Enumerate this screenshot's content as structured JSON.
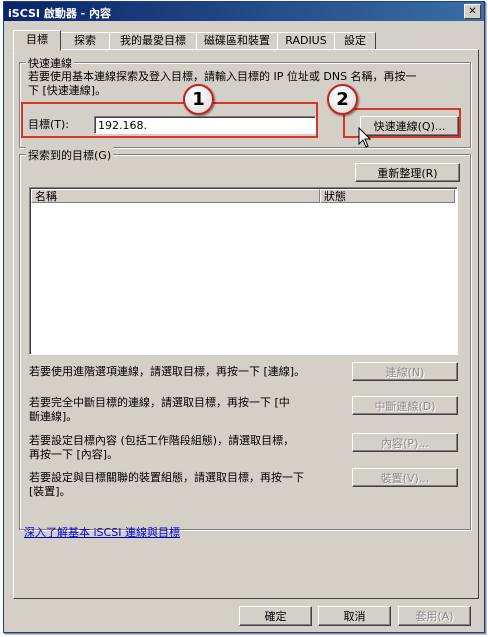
{
  "window": {
    "title": "iSCSI 啟動器 - 內容",
    "close_label": "✕"
  },
  "tabs": [
    {
      "label": "目標",
      "active": true
    },
    {
      "label": "探索",
      "active": false
    },
    {
      "label": "我的最愛目標",
      "active": false
    },
    {
      "label": "磁碟區和裝置",
      "active": false
    },
    {
      "label": "RADIUS",
      "active": false
    },
    {
      "label": "設定",
      "active": false
    }
  ],
  "quick_connect": {
    "group_label": "快速連線",
    "description_line1": "若要使用基本連線探索及登入目標，請輸入目標的 IP 位址或 DNS 名稱，再按一",
    "description_line2": "下 [快速連線]。",
    "target_label": "目標(T):",
    "target_value": "192.168.",
    "button_label": "快速連線(Q)..."
  },
  "discovered": {
    "group_label": "探索到的目標(G)",
    "refresh_label": "重新整理(R)",
    "columns": [
      "名稱",
      "狀態"
    ],
    "actions": [
      {
        "line1": "若要使用進階選項連線，請選取目標，再按一下 [連線]。",
        "line2": "",
        "button": "連線(N)"
      },
      {
        "line1": "若要完全中斷目標的連線，請選取目標，再按一下 [中",
        "line2": "斷連線]。",
        "button": "中斷連線(D)"
      },
      {
        "line1": "若要設定目標內容 (包括工作階段組態)，請選取目標，",
        "line2": "再按一下 [內容]。",
        "button": "內容(P)..."
      },
      {
        "line1": "若要設定與目標關聯的裝置組態，請選取目標，再按一下",
        "line2": "[裝置]。",
        "button": "裝置(V)..."
      }
    ]
  },
  "help_link": "深入了解基本 iSCSI 連線與目標",
  "footer": {
    "ok": "確定",
    "cancel": "取消",
    "apply": "套用(A)"
  },
  "annotations": {
    "badge1": "1",
    "badge2": "2",
    "color": "#d9342b"
  },
  "icons": {
    "close": "close-icon",
    "cursor": "mouse-pointer-icon"
  }
}
